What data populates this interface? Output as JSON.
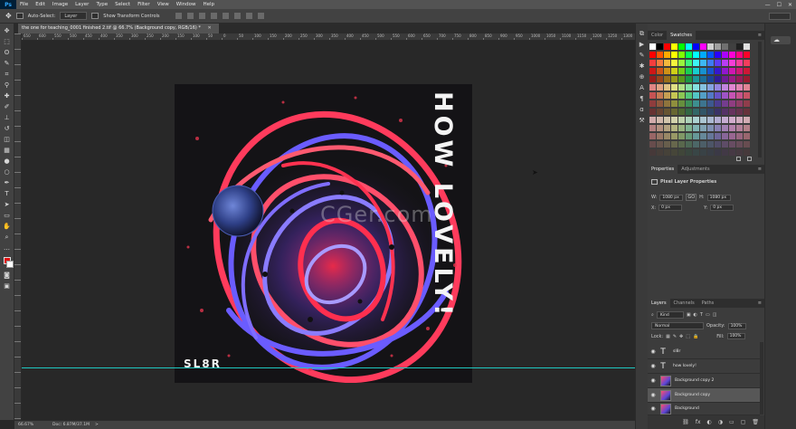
{
  "app": {
    "logo": "Ps"
  },
  "menu": [
    "File",
    "Edit",
    "Image",
    "Layer",
    "Type",
    "Select",
    "Filter",
    "View",
    "Window",
    "Help"
  ],
  "window_controls": {
    "minimize": "—",
    "maximize": "☐",
    "close": "✕"
  },
  "options": {
    "auto_select_label": "Auto-Select:",
    "auto_select_target": "Layer",
    "transform_label": "Show Transform Controls"
  },
  "document": {
    "tab_title": "the one for teaching_0001 finished 2.tif @ 66.7% (Background copy, RGB/16) *",
    "tab_close": "✕"
  },
  "ruler_labels": [
    "650",
    "600",
    "550",
    "500",
    "450",
    "400",
    "350",
    "300",
    "250",
    "200",
    "150",
    "100",
    "50",
    "0",
    "50",
    "100",
    "150",
    "200",
    "250",
    "300",
    "350",
    "400",
    "450",
    "500",
    "550",
    "600",
    "650",
    "700",
    "750",
    "800",
    "850",
    "900",
    "950",
    "1000",
    "1050",
    "1100",
    "1150",
    "1200",
    "1250",
    "1300",
    "1350",
    "1400",
    "1450",
    "1500",
    "1550",
    "1600",
    "1650"
  ],
  "artwork": {
    "title": "HOW LOVELY!",
    "artist": "SL8R",
    "watermark": "CGer.com"
  },
  "status": {
    "zoom": "66.67%",
    "doc": "Doc: 6.87M/37.1M",
    "arrow": ">"
  },
  "color_panel": {
    "tabs": [
      "Color",
      "Swatches"
    ],
    "active_tab": "Swatches"
  },
  "properties_panel": {
    "tabs": [
      "Properties",
      "Adjustments"
    ],
    "active_tab": "Properties",
    "heading": "Pixel Layer Properties",
    "w_label": "W:",
    "w_value": "1080 px",
    "link_label": "GO",
    "h_label": "H:",
    "h_value": "1080 px",
    "x_label": "X:",
    "x_value": "0 px",
    "y_label": "Y:",
    "y_value": "0 px"
  },
  "layers_panel": {
    "tabs": [
      "Layers",
      "Channels",
      "Paths"
    ],
    "active_tab": "Layers",
    "filter_label": "Kind",
    "blend_mode": "Normal",
    "opacity_label": "Opacity:",
    "opacity_value": "100%",
    "lock_label": "Lock:",
    "fill_label": "Fill:",
    "fill_value": "100%",
    "layers": [
      {
        "name": "sl8r",
        "kind": "text",
        "selected": false
      },
      {
        "name": "how lovely!",
        "kind": "text",
        "selected": false
      },
      {
        "name": "Background copy 2",
        "kind": "pixel",
        "selected": false
      },
      {
        "name": "Background copy",
        "kind": "pixel",
        "selected": true
      },
      {
        "name": "Background",
        "kind": "pixel",
        "selected": false
      }
    ],
    "footer_icons": [
      "⛓",
      "fx",
      "◐",
      "◑",
      "▭",
      "▢",
      "🗑"
    ]
  },
  "colors": {
    "accent": "#31a8ff",
    "guide": "#1fc7c0",
    "foreground": "#e01010",
    "background": "#ffffff"
  }
}
